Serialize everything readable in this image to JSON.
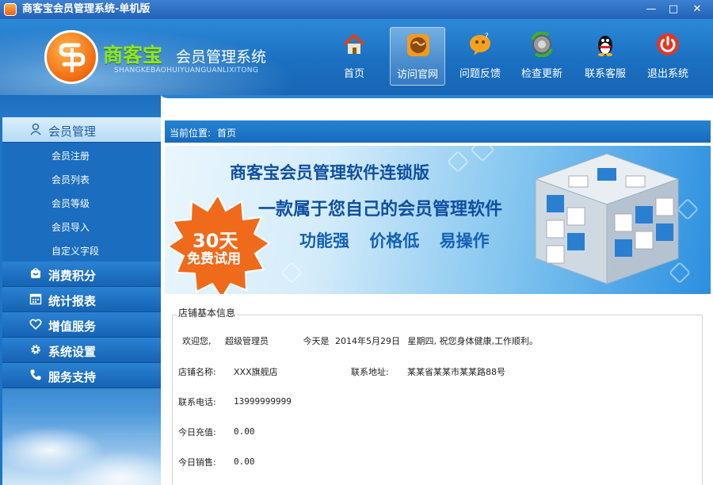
{
  "window": {
    "title": "商客宝会员管理系统-单机版",
    "controls": [
      "—",
      "□",
      "✕"
    ]
  },
  "header": {
    "brand": "商客宝",
    "brand_sub": "会员管理系统",
    "brand_pinyin": "SHANGKEBAOHUIYUANGUANLIXITONG",
    "nav": [
      {
        "label": "首页",
        "icon": "home-icon"
      },
      {
        "label": "访问官网",
        "icon": "globe-icon"
      },
      {
        "label": "问题反馈",
        "icon": "feedback-icon"
      },
      {
        "label": "检查更新",
        "icon": "update-icon"
      },
      {
        "label": "联系客服",
        "icon": "qq-icon"
      },
      {
        "label": "退出系统",
        "icon": "power-icon"
      }
    ]
  },
  "sidebar": {
    "sections": [
      {
        "label": "会员管理",
        "icon": "user-icon",
        "open": true,
        "items": [
          "会员注册",
          "会员列表",
          "会员等级",
          "会员导入",
          "自定义字段"
        ]
      },
      {
        "label": "消费积分",
        "icon": "cart-icon"
      },
      {
        "label": "统计报表",
        "icon": "calendar-icon"
      },
      {
        "label": "增值服务",
        "icon": "heart-icon"
      },
      {
        "label": "系统设置",
        "icon": "gear-icon"
      },
      {
        "label": "服务支持",
        "icon": "phone-icon"
      }
    ]
  },
  "breadcrumb": {
    "label": "当前位置:",
    "current": "首页"
  },
  "banner": {
    "line1": "商客宝会员管理软件连锁版",
    "line2": "一款属于您自己的会员管理软件",
    "line3": "功能强 价格低 易操作",
    "badge_top": "30天",
    "badge_bottom": "免费试用"
  },
  "store_info": {
    "legend": "店铺基本信息",
    "welcome": "欢迎您,",
    "user": "超级管理员",
    "today_text": "今天是",
    "date": "2014年5月29日",
    "weekday": "星期四,",
    "greeting": "祝您身体健康,工作顺利。",
    "name_label": "店铺名称:",
    "name_value": "XXX旗舰店",
    "address_label": "联系地址:",
    "address_value": "某某省某某市某某路88号",
    "phone_label": "联系电话:",
    "phone_value": "13999999999",
    "recharge_label": "今日充值:",
    "recharge_value": "0.00",
    "sales_label": "今日销售:",
    "sales_value": "0.00"
  }
}
